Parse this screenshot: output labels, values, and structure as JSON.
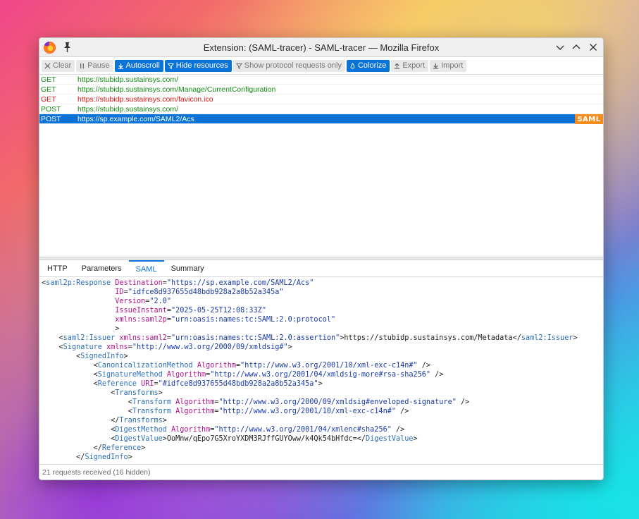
{
  "window": {
    "title": "Extension: (SAML-tracer) - SAML-tracer — Mozilla Firefox"
  },
  "toolbar": {
    "clear": "Clear",
    "pause": "Pause",
    "autoscroll": "Autoscroll",
    "hide_resources": "Hide resources",
    "show_protocol": "Show protocol requests only",
    "colorize": "Colorize",
    "export": "Export",
    "import": "Import"
  },
  "requests": [
    {
      "method": "GET",
      "url": "https://stubidp.sustainsys.com/"
    },
    {
      "method": "GET",
      "url": "https://stubidp.sustainsys.com/Manage/CurrentConfiguration"
    },
    {
      "method": "GET",
      "url": "https://stubidp.sustainsys.com/favicon.ico"
    },
    {
      "method": "POST",
      "url": "https://stubidp.sustainsys.com/"
    },
    {
      "method": "POST",
      "url": "https://sp.example.com/SAML2/Acs",
      "badge": "SAML"
    }
  ],
  "tabs": [
    "HTTP",
    "Parameters",
    "SAML",
    "Summary"
  ],
  "xml": {
    "response_tag": "saml2p:Response",
    "destination_attr": "Destination",
    "destination_val": "\"https://sp.example.com/SAML2/Acs\"",
    "id_attr": "ID",
    "id_val": "\"idfce8d937655d48bdb928a2a8b52a345a\"",
    "version_attr": "Version",
    "version_val": "\"2.0\"",
    "instant_attr": "IssueInstant",
    "instant_val": "\"2025-05-25T12:08:33Z\"",
    "xmlns_p_attr": "xmlns:saml2p",
    "xmlns_p_val": "\"urn:oasis:names:tc:SAML:2.0:protocol\"",
    "issuer_tag": "saml2:Issuer",
    "xmlns_a_attr": "xmlns:saml2",
    "xmlns_a_val": "\"urn:oasis:names:tc:SAML:2.0:assertion\"",
    "issuer_text": "https://stubidp.sustainsys.com/Metadata",
    "signature_tag": "Signature",
    "xmlns_attr": "xmlns",
    "xmlns_ds_val": "\"http://www.w3.org/2000/09/xmldsig#\"",
    "signedinfo_tag": "SignedInfo",
    "canon_tag": "CanonicalizationMethod",
    "algorithm_attr": "Algorithm",
    "canon_val": "\"http://www.w3.org/2001/10/xml-exc-c14n#\"",
    "sigmethod_tag": "SignatureMethod",
    "sigmethod_val": "\"http://www.w3.org/2001/04/xmldsig-more#rsa-sha256\"",
    "reference_tag": "Reference",
    "uri_attr": "URI",
    "uri_val": "\"#idfce8d937655d48bdb928a2a8b52a345a\"",
    "transforms_tag": "Transforms",
    "transform_tag": "Transform",
    "transform1_val": "\"http://www.w3.org/2000/09/xmldsig#enveloped-signature\"",
    "transform2_val": "\"http://www.w3.org/2001/10/xml-exc-c14n#\"",
    "digestmethod_tag": "DigestMethod",
    "digestmethod_val": "\"http://www.w3.org/2001/04/xmlenc#sha256\"",
    "digestvalue_tag": "DigestValue",
    "digestvalue_text": "OoMnw/qEpo7G5XroYXDM3RJffGUYOww/k4Qk54bHfdc="
  },
  "status": {
    "text": "21 requests received (16 hidden)"
  }
}
